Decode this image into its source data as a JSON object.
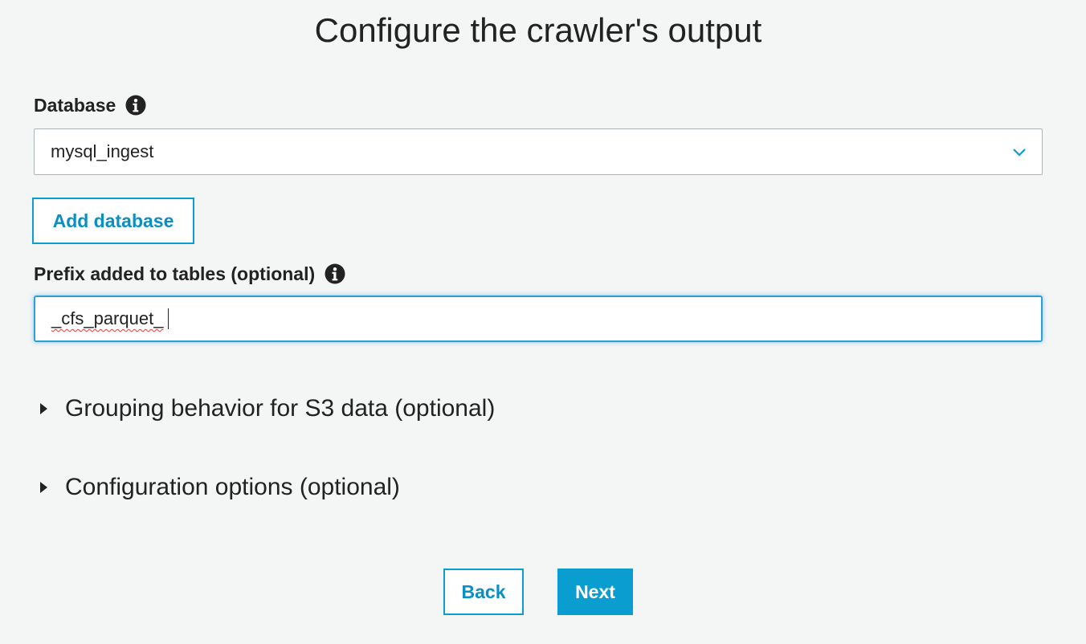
{
  "page": {
    "title": "Configure the crawler's output"
  },
  "database": {
    "label": "Database",
    "selected": "mysql_ingest",
    "add_button": "Add database"
  },
  "prefix": {
    "label": "Prefix added to tables (optional)",
    "value": "_cfs_parquet_"
  },
  "sections": [
    {
      "label": "Grouping behavior for S3 data (optional)"
    },
    {
      "label": "Configuration options (optional)"
    }
  ],
  "footer": {
    "back_label": "Back",
    "next_label": "Next"
  },
  "colors": {
    "accent": "#0a9ed0",
    "background": "#f4f5f5",
    "focus_border": "#2d9fd8"
  },
  "icons": {
    "info": "info-circle-icon",
    "chevron": "chevron-down-icon",
    "expand": "caret-right-icon"
  }
}
